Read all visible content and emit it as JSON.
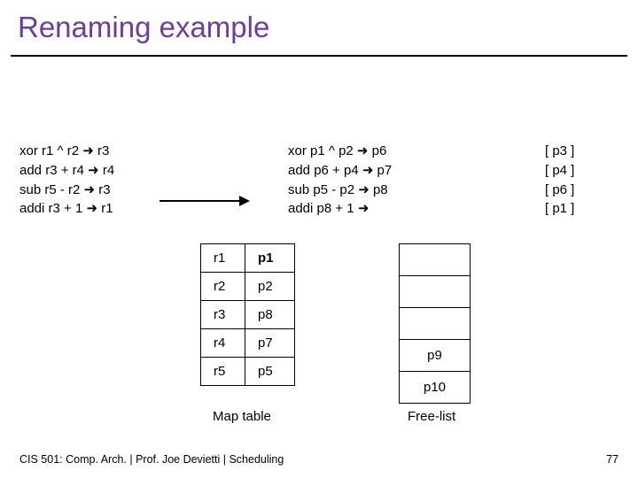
{
  "title": "Renaming example",
  "left_code": [
    "xor r1 ^ r2 ➜ r3",
    "add r3 + r4 ➜ r4",
    "sub r5 - r2 ➜ r3",
    "addi r3 + 1 ➜ r1"
  ],
  "mid_code": [
    "xor  p1 ^ p2 ➜ p6",
    "add p6 + p4 ➜ p7",
    "sub p5 - p2 ➜ p8",
    "addi p8 + 1 ➜"
  ],
  "right_code": [
    "[ p3 ]",
    "[ p4 ]",
    "[ p6 ]",
    "[ p1 ]"
  ],
  "map_rows": [
    {
      "r": "r1",
      "p": "p1",
      "p_hl": true
    },
    {
      "r": "r2",
      "p": "p2",
      "p_hl": false
    },
    {
      "r": "r3",
      "p": "p8",
      "p_hl": false
    },
    {
      "r": "r4",
      "p": "p7",
      "p_hl": false
    },
    {
      "r": "r5",
      "p": "p5",
      "p_hl": false
    }
  ],
  "labels": {
    "map": "Map table",
    "free": "Free-list"
  },
  "free_rows": [
    "",
    "",
    "",
    "p9",
    "p10"
  ],
  "footer": "CIS 501: Comp. Arch.  |  Prof. Joe Devietti  |  Scheduling",
  "page": "77"
}
